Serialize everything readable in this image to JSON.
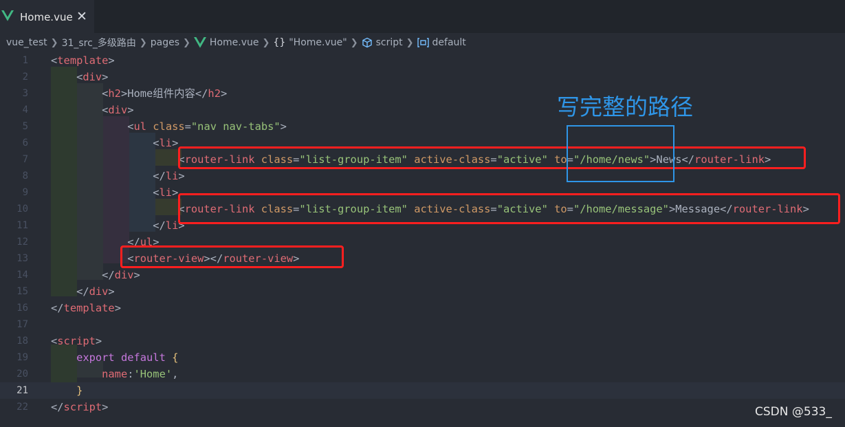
{
  "tab": {
    "label": "Home.vue",
    "close": "✕"
  },
  "breadcrumb": [
    "vue_test",
    "31_src_多级路由",
    "pages",
    "Home.vue",
    "\"Home.vue\"",
    "script",
    "default"
  ],
  "annotation": "写完整的路径",
  "watermark": "CSDN @533_",
  "lines": [
    {
      "n": "1",
      "tokens": [
        [
          "pun",
          "<"
        ],
        [
          "tag",
          "template"
        ],
        [
          "pun",
          ">"
        ]
      ]
    },
    {
      "n": "2",
      "tokens": [
        [
          "pun",
          "    <"
        ],
        [
          "tag",
          "div"
        ],
        [
          "pun",
          ">"
        ]
      ]
    },
    {
      "n": "3",
      "tokens": [
        [
          "pun",
          "        <"
        ],
        [
          "tag",
          "h2"
        ],
        [
          "pun",
          ">"
        ],
        [
          "txt",
          "Home组件内容"
        ],
        [
          "pun",
          "</"
        ],
        [
          "tag",
          "h2"
        ],
        [
          "pun",
          ">"
        ]
      ]
    },
    {
      "n": "4",
      "tokens": [
        [
          "pun",
          "        <"
        ],
        [
          "tag",
          "div"
        ],
        [
          "pun",
          ">"
        ]
      ]
    },
    {
      "n": "5",
      "tokens": [
        [
          "pun",
          "            <"
        ],
        [
          "tag",
          "ul"
        ],
        [
          "attr",
          " class"
        ],
        [
          "pun",
          "="
        ],
        [
          "str",
          "\"nav nav-tabs\""
        ],
        [
          "pun",
          ">"
        ]
      ]
    },
    {
      "n": "6",
      "tokens": [
        [
          "pun",
          "                <"
        ],
        [
          "tag",
          "li"
        ],
        [
          "pun",
          ">"
        ]
      ]
    },
    {
      "n": "7",
      "tokens": [
        [
          "pun",
          "                    <"
        ],
        [
          "tag",
          "router-link"
        ],
        [
          "attr",
          " class"
        ],
        [
          "pun",
          "="
        ],
        [
          "str",
          "\"list-group-item\""
        ],
        [
          "attr",
          " active-class"
        ],
        [
          "pun",
          "="
        ],
        [
          "str",
          "\"active\""
        ],
        [
          "attr",
          " to"
        ],
        [
          "pun",
          "="
        ],
        [
          "str",
          "\"/home/news\""
        ],
        [
          "pun",
          ">"
        ],
        [
          "txt",
          "News"
        ],
        [
          "pun",
          "</"
        ],
        [
          "tag",
          "router-link"
        ],
        [
          "pun",
          ">"
        ]
      ]
    },
    {
      "n": "8",
      "tokens": [
        [
          "pun",
          "                </"
        ],
        [
          "tag",
          "li"
        ],
        [
          "pun",
          ">"
        ]
      ]
    },
    {
      "n": "9",
      "tokens": [
        [
          "pun",
          "                <"
        ],
        [
          "tag",
          "li"
        ],
        [
          "pun",
          ">"
        ]
      ]
    },
    {
      "n": "10",
      "tokens": [
        [
          "pun",
          "                    <"
        ],
        [
          "tag",
          "router-link"
        ],
        [
          "attr",
          " class"
        ],
        [
          "pun",
          "="
        ],
        [
          "str",
          "\"list-group-item\""
        ],
        [
          "attr",
          " active-class"
        ],
        [
          "pun",
          "="
        ],
        [
          "str",
          "\"active\""
        ],
        [
          "attr",
          " to"
        ],
        [
          "pun",
          "="
        ],
        [
          "str",
          "\"/home/message\""
        ],
        [
          "pun",
          ">"
        ],
        [
          "txt",
          "Message"
        ],
        [
          "pun",
          "</"
        ],
        [
          "tag",
          "router-link"
        ],
        [
          "pun",
          ">"
        ]
      ]
    },
    {
      "n": "11",
      "tokens": [
        [
          "pun",
          "                </"
        ],
        [
          "tag",
          "li"
        ],
        [
          "pun",
          ">"
        ]
      ]
    },
    {
      "n": "12",
      "tokens": [
        [
          "pun",
          "            </"
        ],
        [
          "tag",
          "ul"
        ],
        [
          "pun",
          ">"
        ]
      ]
    },
    {
      "n": "13",
      "tokens": [
        [
          "pun",
          "            <"
        ],
        [
          "tag",
          "router-view"
        ],
        [
          "pun",
          "></"
        ],
        [
          "tag",
          "router-view"
        ],
        [
          "pun",
          ">"
        ]
      ]
    },
    {
      "n": "14",
      "tokens": [
        [
          "pun",
          "        </"
        ],
        [
          "tag",
          "div"
        ],
        [
          "pun",
          ">"
        ]
      ]
    },
    {
      "n": "15",
      "tokens": [
        [
          "pun",
          "    </"
        ],
        [
          "tag",
          "div"
        ],
        [
          "pun",
          ">"
        ]
      ]
    },
    {
      "n": "16",
      "tokens": [
        [
          "pun",
          "</"
        ],
        [
          "tag",
          "template"
        ],
        [
          "pun",
          ">"
        ]
      ]
    },
    {
      "n": "17",
      "tokens": []
    },
    {
      "n": "18",
      "tokens": [
        [
          "pun",
          "<"
        ],
        [
          "tag",
          "script"
        ],
        [
          "pun",
          ">"
        ]
      ]
    },
    {
      "n": "19",
      "tokens": [
        [
          "pun",
          "    "
        ],
        [
          "kw",
          "export"
        ],
        [
          "pun",
          " "
        ],
        [
          "kw",
          "default"
        ],
        [
          "pun",
          " "
        ],
        [
          "ybrace",
          "{"
        ]
      ]
    },
    {
      "n": "20",
      "tokens": [
        [
          "pun",
          "        "
        ],
        [
          "prop",
          "name"
        ],
        [
          "pun",
          ":"
        ],
        [
          "str",
          "'Home'"
        ],
        [
          "pun",
          ","
        ]
      ]
    },
    {
      "n": "21",
      "tokens": [
        [
          "pun",
          "    "
        ],
        [
          "ybrace",
          "}"
        ]
      ]
    },
    {
      "n": "22",
      "tokens": [
        [
          "pun",
          "</"
        ],
        [
          "tag",
          "script"
        ],
        [
          "pun",
          ">"
        ]
      ]
    }
  ],
  "current_line": "21"
}
